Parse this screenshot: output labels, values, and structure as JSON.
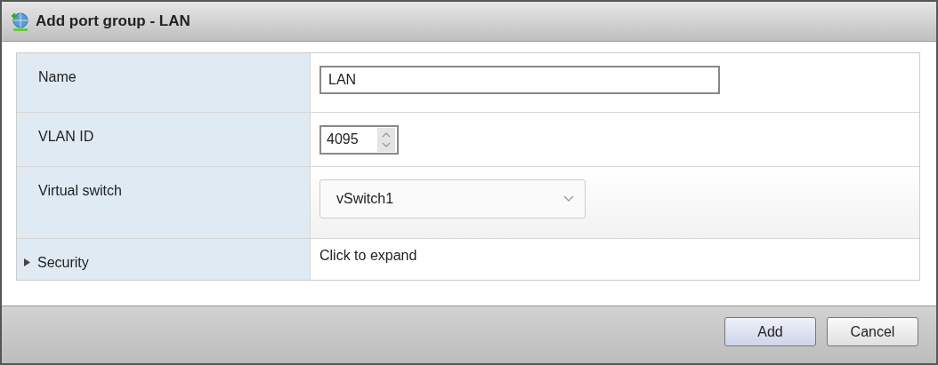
{
  "window": {
    "title": "Add port group - LAN"
  },
  "rows": [
    {
      "kind": "text",
      "label": "Name",
      "value": "LAN"
    },
    {
      "kind": "number",
      "label": "VLAN ID",
      "value": "4095"
    },
    {
      "kind": "select",
      "label": "Virtual switch",
      "value": "vSwitch1"
    },
    {
      "kind": "expander",
      "label": "Security",
      "value": "Click to expand",
      "expanded": false
    }
  ],
  "buttons": [
    {
      "label": "Add",
      "primary": true
    },
    {
      "label": "Cancel",
      "primary": false
    }
  ]
}
